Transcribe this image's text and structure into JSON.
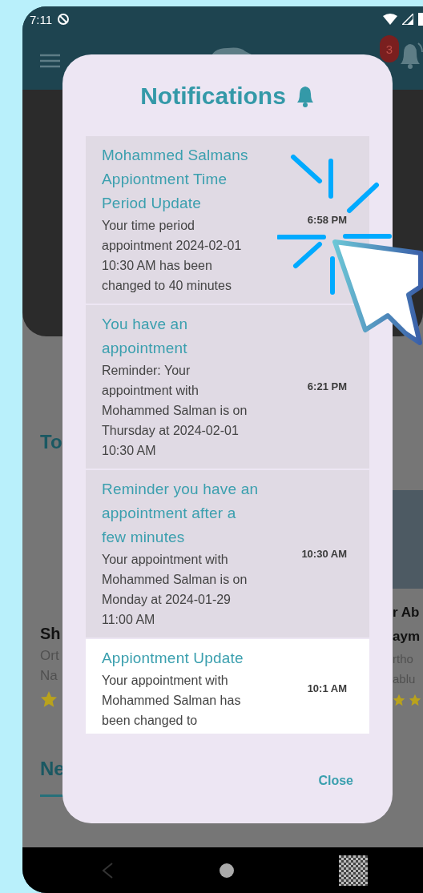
{
  "status_bar": {
    "time": "7:11"
  },
  "app_bar": {
    "badge": "3"
  },
  "background": {
    "section_title": "To",
    "left_card": {
      "name": "Sh",
      "lines": [
        "Ort",
        "Na"
      ]
    },
    "right_card": {
      "name_lines": [
        "r Ab",
        "aym"
      ],
      "lines": [
        "rtho",
        "ablu"
      ]
    },
    "section_title_2": "Ne"
  },
  "dialog": {
    "title": "Notifications",
    "items": [
      {
        "title": "Mohammed Salmans Appiontment Time Period Update",
        "body": "Your time period appointment 2024-02-01 10:30 AM has been changed to 40 minutes",
        "time": "6:58 PM",
        "read": true
      },
      {
        "title": "You have an appointment",
        "body": "Reminder: Your appointment with Mohammed Salman is on Thursday at 2024-02-01 10:30 AM",
        "time": "6:21 PM",
        "read": true
      },
      {
        "title": "Reminder you have an appointment after a few minutes",
        "body": "Your appointment with Mohammed Salman is on Monday at 2024-01-29 11:00 AM",
        "time": "10:30 AM",
        "read": true
      },
      {
        "title": "Appiontment Update",
        "body": "Your appointment with Mohammed Salman has been changed to",
        "time": "10:1 AM",
        "read": false
      }
    ],
    "close": "Close"
  }
}
